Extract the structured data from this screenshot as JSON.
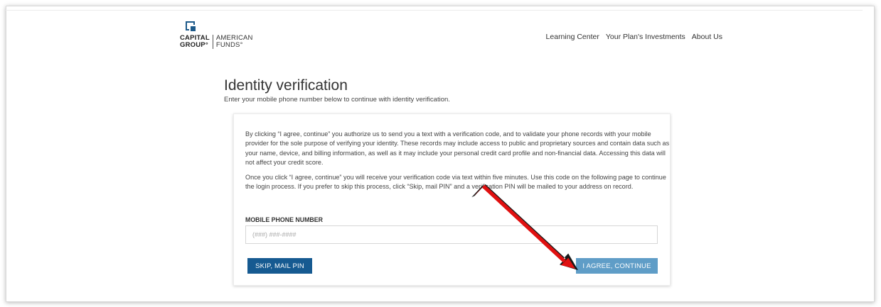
{
  "logo": {
    "line1_left": "CAPITAL",
    "line2_left": "GROUP°",
    "line1_right": "AMERICAN",
    "line2_right": "FUNDS°"
  },
  "nav": {
    "items": [
      {
        "label": "Learning Center"
      },
      {
        "label": "Your Plan's Investments"
      },
      {
        "label": "About Us"
      }
    ]
  },
  "page": {
    "title": "Identity verification",
    "subtitle": "Enter your mobile phone number below to continue with identity verification."
  },
  "card": {
    "paragraph1": "By clicking “I agree, continue” you authorize us to send you a text with a verification code, and to validate your phone records with your mobile provider for the sole purpose of verifying your identity. These records may include access to public and proprietary sources and contain data such as your name, device, and billing information, as well as it may include your personal credit card profile and non-financial data. Accessing this data will not affect your credit score.",
    "paragraph2": "Once you click “I agree, continue” you will receive your verification code via text within five minutes. Use this code on the following page to continue the login process. If you prefer to skip this process, click “Skip, mail PIN” and a verification PIN will be mailed to your address on record.",
    "phone_label": "MOBILE PHONE NUMBER",
    "phone_value": "",
    "phone_placeholder": "(###) ###-####",
    "skip_button": "SKIP, MAIL PIN",
    "agree_button": "I AGREE, CONTINUE"
  },
  "colors": {
    "brand_blue": "#165a91",
    "agree_blue": "#5f9dc7",
    "annotation_arrow": "#e01010"
  },
  "icons": {
    "logo": "capital-group-logo-icon",
    "annotation": "red-arrow-icon"
  }
}
